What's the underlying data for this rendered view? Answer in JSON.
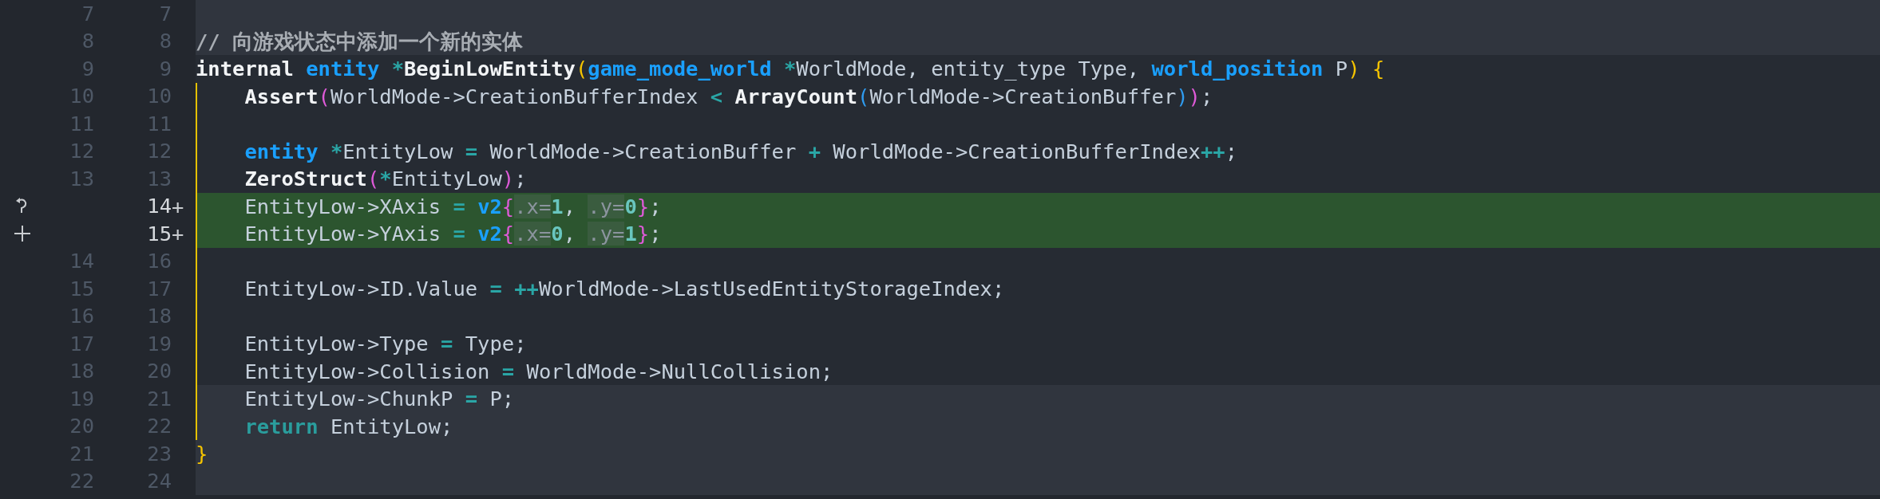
{
  "lines": [
    {
      "old": "7",
      "new": "7",
      "kind": "outside"
    },
    {
      "old": "8",
      "new": "8",
      "kind": "outside",
      "tokens": [
        {
          "kind": "cm",
          "text": "// 向游戏状态中添加一个新的实体"
        }
      ]
    },
    {
      "old": "9",
      "new": "9",
      "kind": "signature",
      "tokens": [
        {
          "kind": "kw",
          "text": "internal "
        },
        {
          "kind": "type",
          "text": "entity "
        },
        {
          "kind": "op",
          "text": "*"
        },
        {
          "kind": "kw",
          "text": "BeginLowEntity"
        },
        {
          "kind": "py",
          "text": "("
        },
        {
          "kind": "type",
          "text": "game_mode_world "
        },
        {
          "kind": "op",
          "text": "*"
        },
        {
          "kind": "txt",
          "text": "WorldMode, entity_type Type, "
        },
        {
          "kind": "type",
          "text": "world_position"
        },
        {
          "kind": "txt",
          "text": " P"
        },
        {
          "kind": "py",
          "text": ") {"
        }
      ]
    },
    {
      "old": "10",
      "new": "10",
      "kind": "body",
      "tokens": [
        {
          "kind": "kw",
          "text": "    Assert"
        },
        {
          "kind": "pp",
          "text": "("
        },
        {
          "kind": "txt",
          "text": "WorldMode->CreationBufferIndex "
        },
        {
          "kind": "op",
          "text": "< "
        },
        {
          "kind": "kw",
          "text": "ArrayCount"
        },
        {
          "kind": "pb",
          "text": "("
        },
        {
          "kind": "txt",
          "text": "WorldMode->CreationBuffer"
        },
        {
          "kind": "pb",
          "text": ")"
        },
        {
          "kind": "pp",
          "text": ")"
        },
        {
          "kind": "txt",
          "text": ";"
        }
      ]
    },
    {
      "old": "11",
      "new": "11",
      "kind": "body"
    },
    {
      "old": "12",
      "new": "12",
      "kind": "body",
      "tokens": [
        {
          "kind": "type",
          "text": "    entity "
        },
        {
          "kind": "op",
          "text": "*"
        },
        {
          "kind": "txt",
          "text": "EntityLow "
        },
        {
          "kind": "op",
          "text": "="
        },
        {
          "kind": "txt",
          "text": " WorldMode->CreationBuffer "
        },
        {
          "kind": "op",
          "text": "+"
        },
        {
          "kind": "txt",
          "text": " WorldMode->CreationBufferIndex"
        },
        {
          "kind": "op",
          "text": "++"
        },
        {
          "kind": "txt",
          "text": ";"
        }
      ]
    },
    {
      "old": "13",
      "new": "13",
      "kind": "body",
      "tokens": [
        {
          "kind": "kw",
          "text": "    ZeroStruct"
        },
        {
          "kind": "pp",
          "text": "("
        },
        {
          "kind": "op",
          "text": "*"
        },
        {
          "kind": "txt",
          "text": "EntityLow"
        },
        {
          "kind": "pp",
          "text": ")"
        },
        {
          "kind": "txt",
          "text": ";"
        }
      ]
    },
    {
      "new": "14",
      "new_mark": "+",
      "gutter": {
        "kind": "revert"
      },
      "kind": "added",
      "tokens": [
        {
          "kind": "txt",
          "text": "    EntityLow->XAxis "
        },
        {
          "kind": "op",
          "text": "= "
        },
        {
          "kind": "type",
          "text": "v2"
        },
        {
          "kind": "pp",
          "text": "{"
        },
        {
          "kind": "hint",
          "text": ".x="
        },
        {
          "kind": "num",
          "text": "1"
        },
        {
          "kind": "txt",
          "text": ", "
        },
        {
          "kind": "hint",
          "text": ".y="
        },
        {
          "kind": "num",
          "text": "0"
        },
        {
          "kind": "pp",
          "text": "}"
        },
        {
          "kind": "txt",
          "text": ";"
        }
      ]
    },
    {
      "new": "15",
      "new_mark": "+",
      "gutter": {
        "kind": "plus"
      },
      "kind": "added",
      "tokens": [
        {
          "kind": "txt",
          "text": "    EntityLow->YAxis "
        },
        {
          "kind": "op",
          "text": "= "
        },
        {
          "kind": "type",
          "text": "v2"
        },
        {
          "kind": "pp",
          "text": "{"
        },
        {
          "kind": "hint",
          "text": ".x="
        },
        {
          "kind": "num",
          "text": "0"
        },
        {
          "kind": "txt",
          "text": ", "
        },
        {
          "kind": "hint",
          "text": ".y="
        },
        {
          "kind": "num",
          "text": "1"
        },
        {
          "kind": "pp",
          "text": "}"
        },
        {
          "kind": "txt",
          "text": ";"
        }
      ]
    },
    {
      "old": "14",
      "new": "16",
      "kind": "body"
    },
    {
      "old": "15",
      "new": "17",
      "kind": "body",
      "tokens": [
        {
          "kind": "txt",
          "text": "    EntityLow->ID.Value "
        },
        {
          "kind": "op",
          "text": "= ++"
        },
        {
          "kind": "txt",
          "text": "WorldMode->LastUsedEntityStorageIndex;"
        }
      ]
    },
    {
      "old": "16",
      "new": "18",
      "kind": "body"
    },
    {
      "old": "17",
      "new": "19",
      "kind": "body",
      "tokens": [
        {
          "kind": "txt",
          "text": "    EntityLow->Type "
        },
        {
          "kind": "op",
          "text": "="
        },
        {
          "kind": "txt",
          "text": " Type;"
        }
      ]
    },
    {
      "old": "18",
      "new": "20",
      "kind": "body",
      "tokens": [
        {
          "kind": "txt",
          "text": "    EntityLow->Collision "
        },
        {
          "kind": "op",
          "text": "="
        },
        {
          "kind": "txt",
          "text": " WorldMode->NullCollision;"
        }
      ]
    },
    {
      "old": "19",
      "new": "21",
      "kind": "tail",
      "tokens": [
        {
          "kind": "txt",
          "text": "    EntityLow->ChunkP "
        },
        {
          "kind": "op",
          "text": "="
        },
        {
          "kind": "txt",
          "text": " P;"
        }
      ]
    },
    {
      "old": "20",
      "new": "22",
      "kind": "tail",
      "tokens": [
        {
          "kind": "ret",
          "text": "    return"
        },
        {
          "kind": "txt",
          "text": " EntityLow;"
        }
      ]
    },
    {
      "old": "21",
      "new": "23",
      "kind": "outside",
      "tokens": [
        {
          "kind": "py",
          "text": "}"
        }
      ]
    },
    {
      "old": "22",
      "new": "24",
      "kind": "outside"
    }
  ]
}
